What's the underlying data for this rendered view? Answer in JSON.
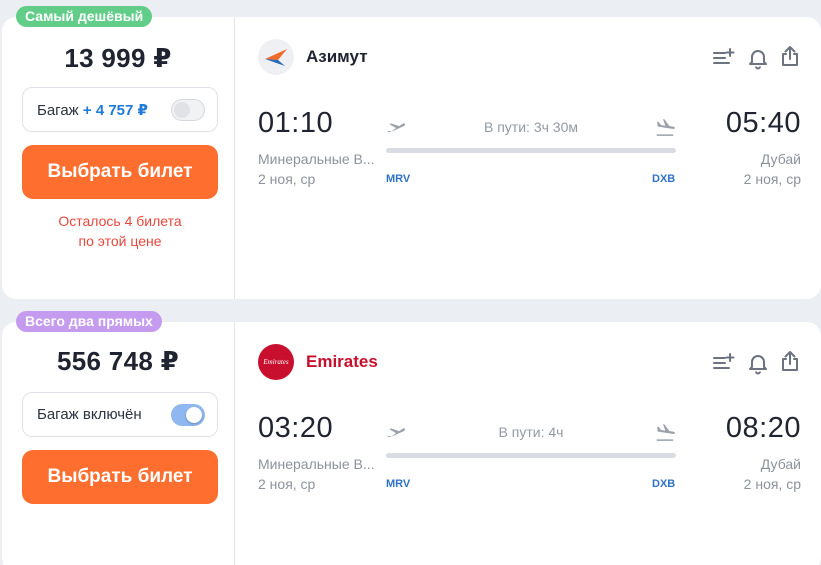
{
  "offers": [
    {
      "badge": "Самый дешёвый",
      "badge_color": "#62cd89",
      "price": "13 999 ₽",
      "baggage_label": "Багаж",
      "baggage_extra": "+ 4 757 ₽",
      "baggage_included": false,
      "buy_label": "Выбрать билет",
      "warning_line1": "Осталось 4 билета",
      "warning_line2": "по этой цене",
      "airline": "Азимут",
      "airline_color": "#1f2430",
      "dep_time": "01:10",
      "arr_time": "05:40",
      "duration": "В пути: 3ч 30м",
      "dep_city": "Минеральные В...",
      "arr_city": "Дубай",
      "dep_date": "2 ноя, ср",
      "arr_date": "2 ноя, ср",
      "dep_code": "MRV",
      "arr_code": "DXB"
    },
    {
      "badge": "Всего два прямых",
      "badge_color": "#c49bef",
      "price": "556 748 ₽",
      "baggage_label": "Багаж включён",
      "baggage_extra": "",
      "baggage_included": true,
      "buy_label": "Выбрать билет",
      "airline": "Emirates",
      "airline_logo_text": "Emirates",
      "airline_color": "#c8102e",
      "dep_time": "03:20",
      "arr_time": "08:20",
      "duration": "В пути: 4ч",
      "dep_city": "Минеральные В...",
      "arr_city": "Дубай",
      "dep_date": "2 ноя, ср",
      "arr_date": "2 ноя, ср",
      "dep_code": "MRV",
      "arr_code": "DXB"
    }
  ],
  "icons": [
    "add-to-list-icon",
    "bell-icon",
    "share-icon",
    "plane-takeoff-icon",
    "plane-landing-icon"
  ],
  "colors": {
    "accent": "#fe6e2f",
    "link": "#1f7ad8",
    "warning": "#e7473c",
    "code": "#2f73c7"
  }
}
